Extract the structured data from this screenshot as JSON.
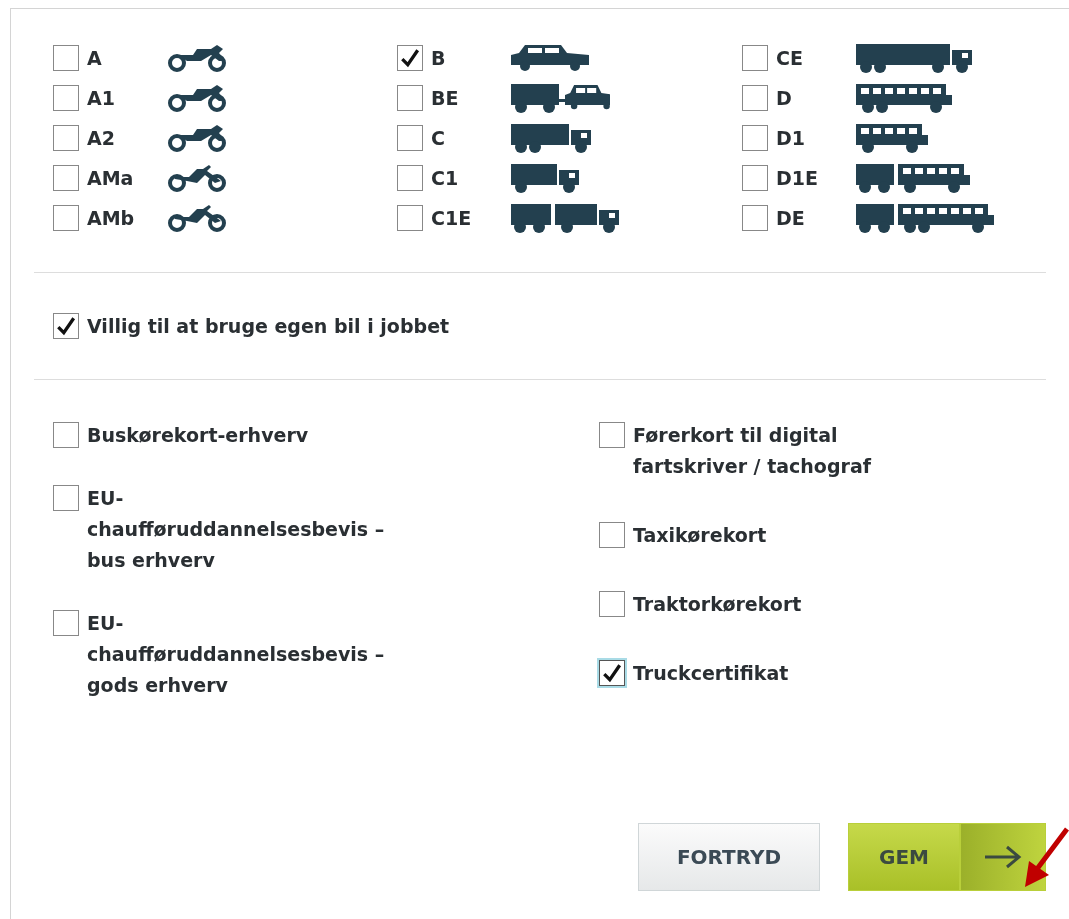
{
  "category_columns": [
    {
      "items": [
        {
          "label": "A",
          "kind": "motorcycle",
          "checked": false
        },
        {
          "label": "A1",
          "kind": "motorcycle",
          "checked": false
        },
        {
          "label": "A2",
          "kind": "motorcycle",
          "checked": false
        },
        {
          "label": "AMa",
          "kind": "moped",
          "checked": false
        },
        {
          "label": "AMb",
          "kind": "moped",
          "checked": false
        }
      ]
    },
    {
      "items": [
        {
          "label": "B",
          "kind": "car",
          "checked": true
        },
        {
          "label": "BE",
          "kind": "car-trailer",
          "checked": false
        },
        {
          "label": "C",
          "kind": "truck",
          "checked": false
        },
        {
          "label": "C1",
          "kind": "small-truck",
          "checked": false
        },
        {
          "label": "C1E",
          "kind": "truck-trailer",
          "checked": false
        }
      ]
    },
    {
      "items": [
        {
          "label": "CE",
          "kind": "semi-truck",
          "checked": false
        },
        {
          "label": "D",
          "kind": "bus",
          "checked": false
        },
        {
          "label": "D1",
          "kind": "minibus",
          "checked": false
        },
        {
          "label": "D1E",
          "kind": "minibus-trailer",
          "checked": false
        },
        {
          "label": "DE",
          "kind": "bus-trailer",
          "checked": false
        }
      ]
    }
  ],
  "own_car": {
    "label": "Villig til at bruge egen bil i jobbet",
    "checked": true
  },
  "certificate_columns": [
    {
      "items": [
        {
          "label": "Buskørekort-erhverv",
          "checked": false,
          "focused": false
        },
        {
          "label": "EU-chaufføruddannelsesbevis – bus erhverv",
          "checked": false,
          "focused": false
        },
        {
          "label": "EU-chaufføruddannelsesbevis – gods erhverv",
          "checked": false,
          "focused": false
        }
      ]
    },
    {
      "items": [
        {
          "label": "Førerkort til digital fartskriver / tachograf",
          "checked": false,
          "focused": false
        },
        {
          "label": "Taxikørekort",
          "checked": false,
          "focused": false
        },
        {
          "label": "Traktorkørekort",
          "checked": false,
          "focused": false
        },
        {
          "label": "Truckcertifikat",
          "checked": true,
          "focused": true
        }
      ]
    }
  ],
  "buttons": [
    {
      "label": "FORTRYD",
      "kind": "secondary"
    },
    {
      "label": "GEM",
      "kind": "primary"
    }
  ]
}
